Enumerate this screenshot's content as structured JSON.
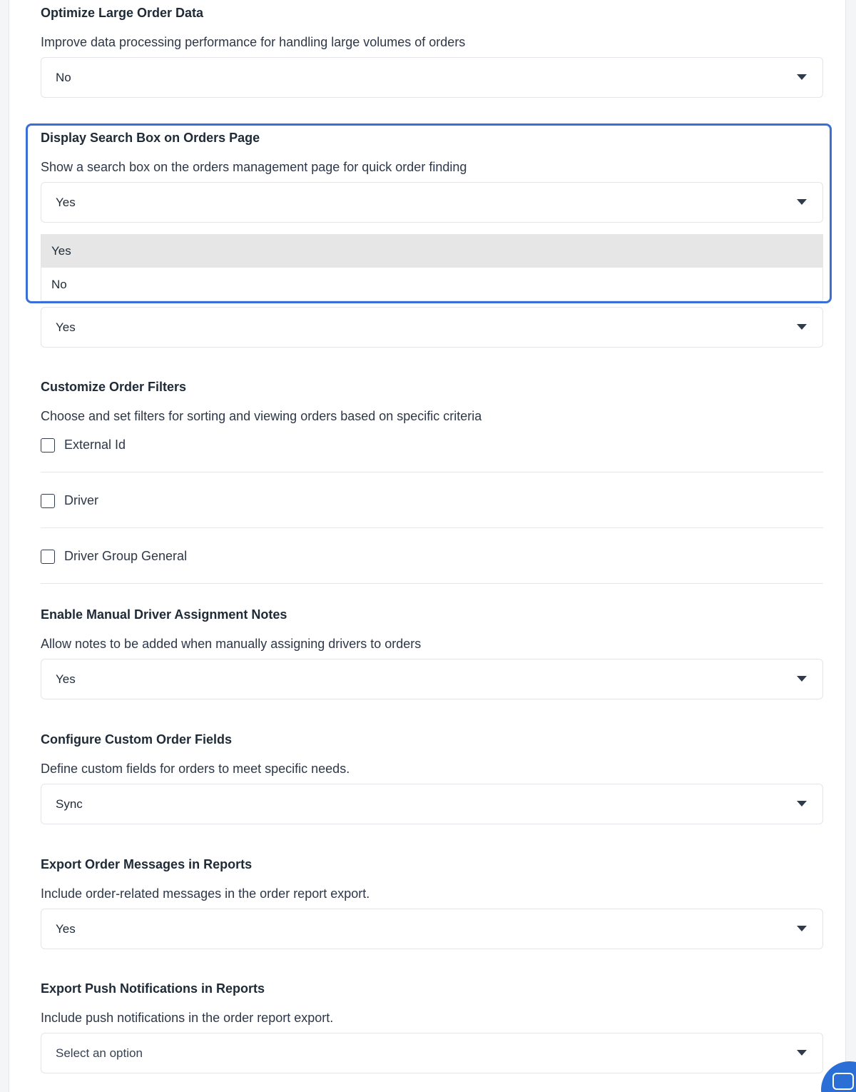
{
  "sections": {
    "optimize": {
      "title": "Optimize Large Order Data",
      "description": "Improve data processing performance for handling large volumes of orders",
      "value": "No"
    },
    "search_box": {
      "title": "Display Search Box on Orders Page",
      "description": "Show a search box on the orders management page for quick order finding",
      "value": "Yes",
      "options": [
        "Yes",
        "No"
      ],
      "highlighted_option": "Yes"
    },
    "hidden_setting": {
      "value": "Yes"
    },
    "filters": {
      "title": "Customize Order Filters",
      "description": "Choose and set filters for sorting and viewing orders based on specific criteria",
      "items": [
        {
          "label": "External Id",
          "checked": false
        },
        {
          "label": "Driver",
          "checked": false
        },
        {
          "label": "Driver Group General",
          "checked": false
        }
      ]
    },
    "manual_notes": {
      "title": "Enable Manual Driver Assignment Notes",
      "description": "Allow notes to be added when manually assigning drivers to orders",
      "value": "Yes"
    },
    "custom_fields": {
      "title": "Configure Custom Order Fields",
      "description": "Define custom fields for orders to meet specific needs.",
      "value": "Sync"
    },
    "export_messages": {
      "title": "Export Order Messages in Reports",
      "description": "Include order-related messages in the order report export.",
      "value": "Yes"
    },
    "export_push": {
      "title": "Export Push Notifications in Reports",
      "description": "Include push notifications in the order report export.",
      "placeholder": "Select an option"
    }
  },
  "colors": {
    "focus_border": "#3b6fd8",
    "highlight_option": "#e6e6e6",
    "chat_button": "#2b6fd6"
  }
}
